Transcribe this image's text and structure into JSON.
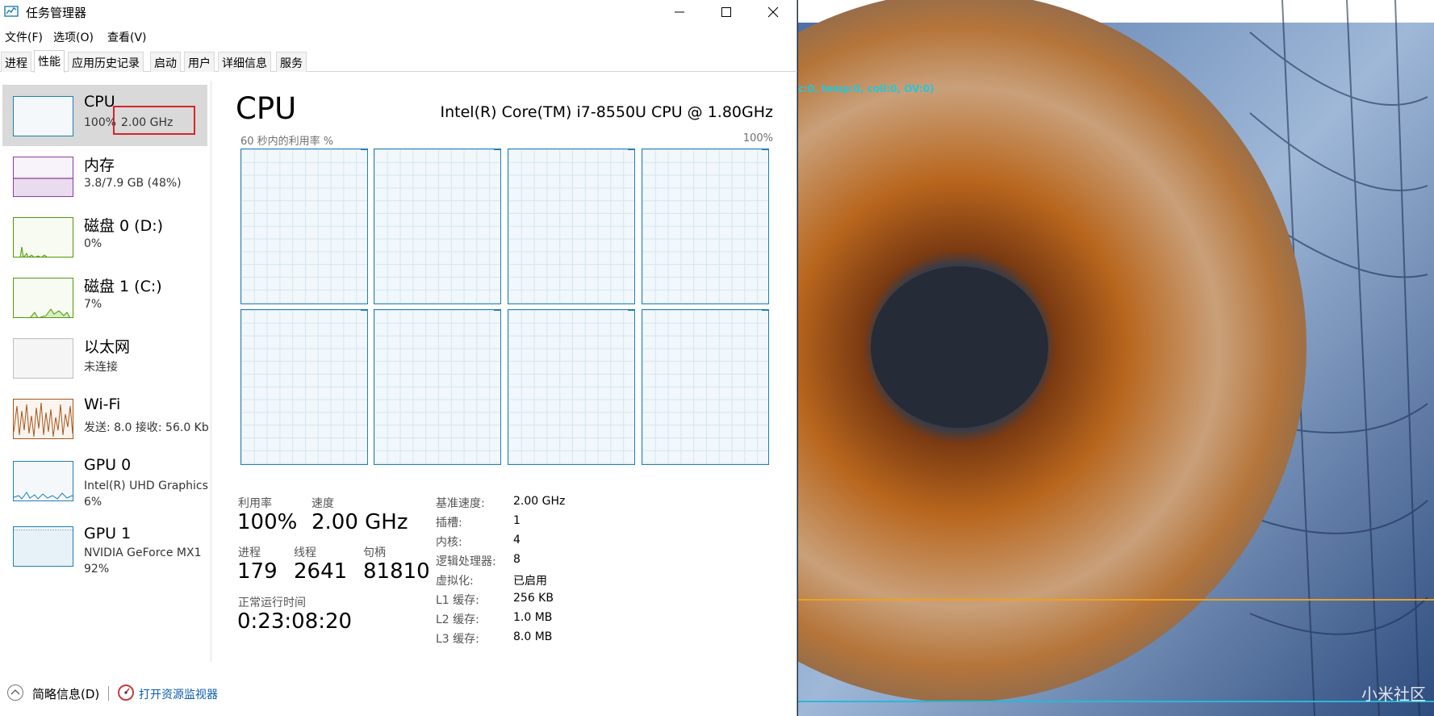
{
  "window": {
    "title": "任务管理器"
  },
  "menu": [
    "文件(F)",
    "选项(O)",
    "查看(V)"
  ],
  "tabs": [
    "进程",
    "性能",
    "应用历史记录",
    "启动",
    "用户",
    "详细信息",
    "服务"
  ],
  "sidebar": {
    "items": [
      {
        "title": "CPU",
        "sub1": "100%",
        "sub1b": "2.00 GHz"
      },
      {
        "title": "内存",
        "sub1": "3.8/7.9 GB (48%)"
      },
      {
        "title": "磁盘 0 (D:)",
        "sub1": "0%"
      },
      {
        "title": "磁盘 1 (C:)",
        "sub1": "7%"
      },
      {
        "title": "以太网",
        "sub1": "未连接"
      },
      {
        "title": "Wi-Fi",
        "sub1": "发送: 8.0 接收: 56.0 Kb"
      },
      {
        "title": "GPU 0",
        "sub1": "Intel(R) UHD Graphics",
        "sub2": "6%"
      },
      {
        "title": "GPU 1",
        "sub1": "NVIDIA GeForce MX1",
        "sub2": "92%"
      }
    ]
  },
  "main": {
    "heading": "CPU",
    "model": "Intel(R) Core(TM) i7-8550U CPU @ 1.80GHz",
    "util_label": "60 秒内的利用率 %",
    "util_max": "100%",
    "stats": {
      "util_label": "利用率",
      "util_value": "100%",
      "speed_label": "速度",
      "speed_value": "2.00 GHz",
      "proc_label": "进程",
      "proc_value": "179",
      "thread_label": "线程",
      "thread_value": "2641",
      "handle_label": "句柄",
      "handle_value": "81810",
      "uptime_label": "正常运行时间",
      "uptime_value": "0:23:08:20"
    },
    "specs": [
      {
        "k": "基准速度:",
        "v": "2.00 GHz"
      },
      {
        "k": "插槽:",
        "v": "1"
      },
      {
        "k": "内核:",
        "v": "4"
      },
      {
        "k": "逻辑处理器:",
        "v": "8"
      },
      {
        "k": "虚拟化:",
        "v": "已启用"
      },
      {
        "k": "L1 缓存:",
        "v": "256 KB"
      },
      {
        "k": "L2 缓存:",
        "v": "1.0 MB"
      },
      {
        "k": "L3 缓存:",
        "v": "8.0 MB"
      }
    ]
  },
  "footer": {
    "fewer": "简略信息(D)",
    "resmon": "打开资源监视器"
  },
  "wallpaper": {
    "overlay": "c:0, temp:0, coll:0, OV:0)",
    "watermark": "小米社区"
  },
  "colors": {
    "graph_border": "#1f7fb4",
    "memory": "#8b3a9e",
    "disk": "#4e9a06",
    "wifi": "#a8541a",
    "highlight": "#d8232a"
  }
}
